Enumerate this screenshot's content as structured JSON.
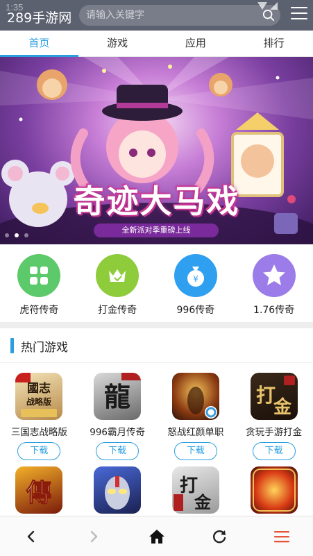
{
  "status": {
    "time": "1:35"
  },
  "header": {
    "title": "289手游网",
    "search_placeholder": "请输入关键字"
  },
  "tabs": [
    {
      "label": "首页",
      "active": true
    },
    {
      "label": "游戏",
      "active": false
    },
    {
      "label": "应用",
      "active": false
    },
    {
      "label": "排行",
      "active": false
    }
  ],
  "banner": {
    "title": "奇迹大马戏",
    "subtitle": "全新派对季重磅上线",
    "dots": 3,
    "active_dot": 1
  },
  "quick_links": [
    {
      "label": "虎符传奇",
      "color": "#5cc96a",
      "icon": "grid-icon"
    },
    {
      "label": "打金传奇",
      "color": "#8fcc3c",
      "icon": "crown-icon"
    },
    {
      "label": "996传奇",
      "color": "#2f9ff0",
      "icon": "money-bag-icon"
    },
    {
      "label": "1.76传奇",
      "color": "#9b7ce8",
      "icon": "star-icon"
    }
  ],
  "section": {
    "title": "热门游戏"
  },
  "games": [
    {
      "name": "三国志战略版",
      "download_label": "下载"
    },
    {
      "name": "996霸月传奇",
      "download_label": "下载"
    },
    {
      "name": "怒战红颜单职",
      "download_label": "下载"
    },
    {
      "name": "贪玩手游打金",
      "download_label": "下载"
    },
    {
      "name": "",
      "download_label": ""
    },
    {
      "name": "",
      "download_label": ""
    },
    {
      "name": "",
      "download_label": ""
    },
    {
      "name": "",
      "download_label": ""
    }
  ],
  "bottom_nav": [
    {
      "name": "back-button",
      "icon": "chevron-left-icon"
    },
    {
      "name": "forward-button",
      "icon": "chevron-right-icon"
    },
    {
      "name": "home-button",
      "icon": "home-icon"
    },
    {
      "name": "refresh-button",
      "icon": "refresh-icon"
    },
    {
      "name": "menu-button",
      "icon": "hamburger-menu-icon"
    }
  ],
  "colors": {
    "accent": "#2a9fe0",
    "header_bg": "#5c6170",
    "menu_red": "#e8563a"
  }
}
